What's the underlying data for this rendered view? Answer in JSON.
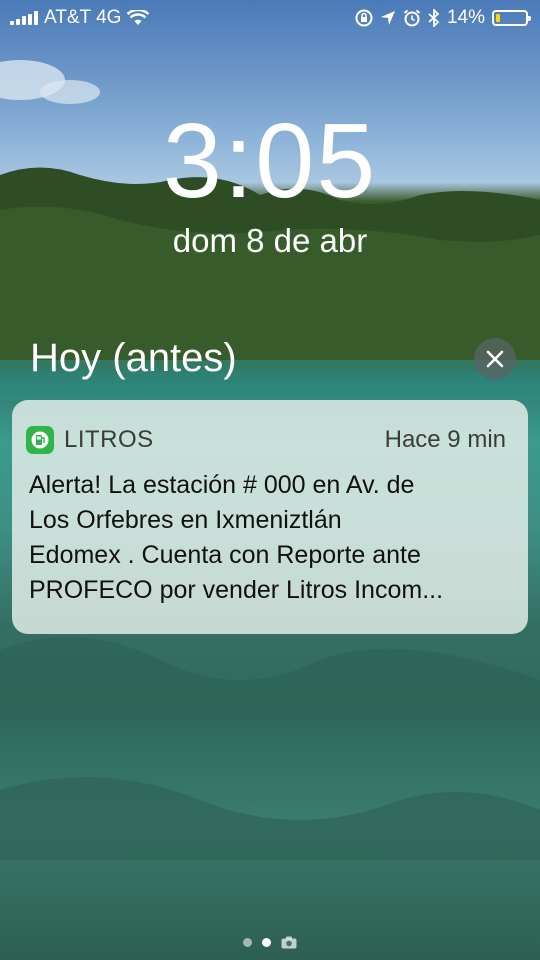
{
  "status_bar": {
    "carrier": "AT&T 4G",
    "battery_percent_label": "14%",
    "battery_level": 0.14,
    "icons": [
      "signal-bars-icon",
      "wifi-icon",
      "rotation-lock-icon",
      "location-arrow-icon",
      "alarm-clock-icon",
      "bluetooth-icon",
      "battery-icon"
    ]
  },
  "lock_screen": {
    "time": "3:05",
    "date": "dom 8 de abr"
  },
  "notifications": {
    "section_title": "Hoy (antes)",
    "clear_icon": "close-icon",
    "items": [
      {
        "app_name": "LITROS",
        "app_icon": "litros-app-icon",
        "time": "Hace 9 min",
        "body_lines": [
          "Alerta! La estación # 000 en Av. de",
          "Los Orfebres en Ixmeniztlán",
          "Edomex . Cuenta con Reporte ante",
          "PROFECO por vender Litros Incom..."
        ]
      }
    ]
  },
  "page_indicator": {
    "pages": 3,
    "current": 2,
    "last_icon": "camera-icon"
  },
  "colors": {
    "accent_green": "#2fb34a",
    "battery_low": "#ffd60a"
  }
}
